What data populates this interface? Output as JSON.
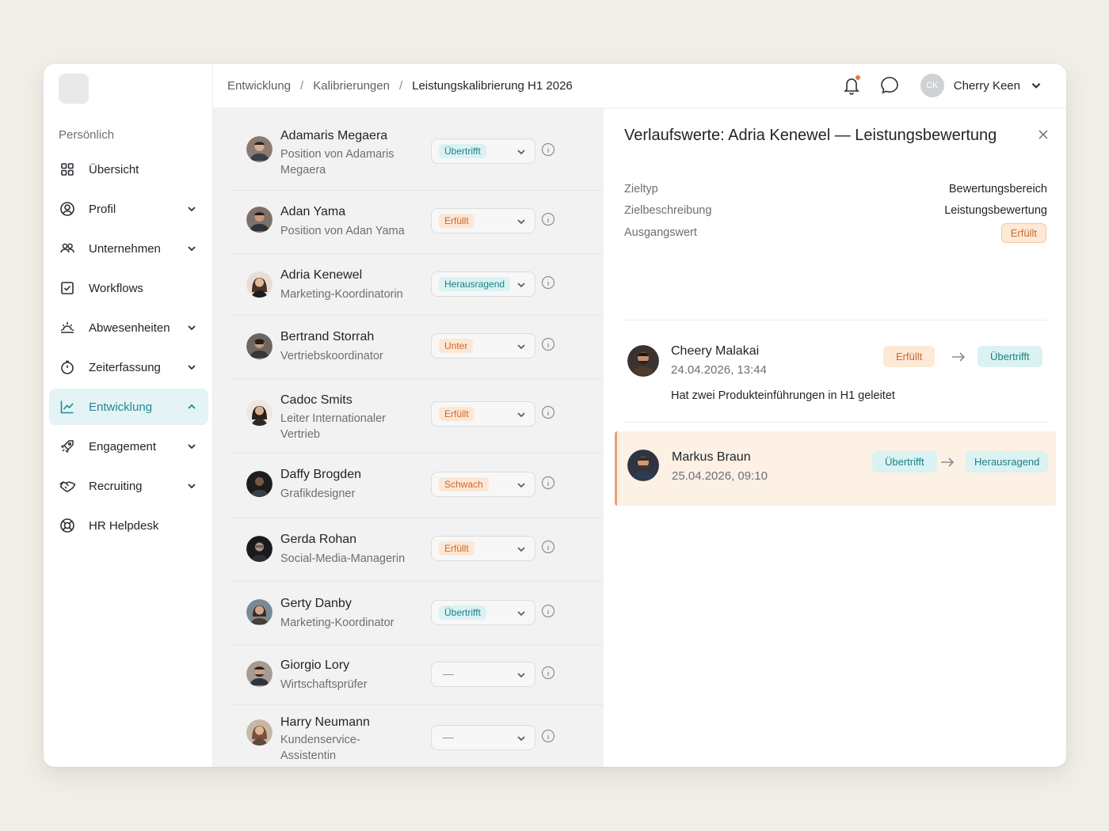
{
  "breadcrumb": {
    "items": [
      "Entwicklung",
      "Kalibrierungen"
    ],
    "separator": "/",
    "current": "Leistungskalibrierung H1 2026"
  },
  "user": {
    "initials": "CK",
    "name": "Cherry Keen"
  },
  "sidebar": {
    "section_label": "Persönlich",
    "items": [
      {
        "label": "Übersicht",
        "icon": "grid-icon"
      },
      {
        "label": "Profil",
        "icon": "user-circle-icon"
      },
      {
        "label": "Unternehmen",
        "icon": "people-icon"
      },
      {
        "label": "Workflows",
        "icon": "checkbox-icon"
      },
      {
        "label": "Abwesenheiten",
        "icon": "sunrise-icon"
      },
      {
        "label": "Zeiterfassung",
        "icon": "stopwatch-icon"
      },
      {
        "label": "Entwicklung",
        "icon": "trend-icon"
      },
      {
        "label": "Engagement",
        "icon": "rocket-icon"
      },
      {
        "label": "Recruiting",
        "icon": "handshake-icon"
      },
      {
        "label": "HR Helpdesk",
        "icon": "lifebuoy-icon"
      }
    ],
    "active": "Entwicklung"
  },
  "employees": [
    {
      "name": "Adamaris Megaera",
      "position": "Position von Adamaris Megaera",
      "rating": "Übertrifft",
      "tone": "teal"
    },
    {
      "name": "Adan Yama",
      "position": "Position von Adan Yama",
      "rating": "Erfüllt",
      "tone": "orange"
    },
    {
      "name": "Adria Kenewel",
      "position": "Marketing-Koordinatorin",
      "rating": "Herausragend",
      "tone": "teal"
    },
    {
      "name": "Bertrand Storrah",
      "position": "Vertriebskoordinator",
      "rating": "Unter",
      "tone": "orange"
    },
    {
      "name": "Cadoc Smits",
      "position": "Leiter Internationaler Vertrieb",
      "rating": "Erfüllt",
      "tone": "orange"
    },
    {
      "name": "Daffy Brogden",
      "position": "Grafikdesigner",
      "rating": "Schwach",
      "tone": "orange"
    },
    {
      "name": "Gerda Rohan",
      "position": "Social-Media-Managerin",
      "rating": "Erfüllt",
      "tone": "orange"
    },
    {
      "name": "Gerty Danby",
      "position": "Marketing-Koordinator",
      "rating": "Übertrifft",
      "tone": "teal"
    },
    {
      "name": "Giorgio Lory",
      "position": "Wirtschaftsprüfer",
      "rating": "—",
      "tone": "none"
    },
    {
      "name": "Harry Neumann",
      "position": "Kundenservice-Assistentin",
      "rating": "—",
      "tone": "none"
    }
  ],
  "detail": {
    "title": "Verlaufswerte: Adria Kenewel — Leistungsbewertung",
    "meta": [
      {
        "key": "Zieltyp",
        "value": "Bewertungsbereich"
      },
      {
        "key": "Zielbeschreibung",
        "value": "Leistungsbewertung"
      },
      {
        "key": "Ausgangswert",
        "value": "Erfüllt"
      }
    ],
    "history": [
      {
        "name": "Cheery Malakai",
        "date": "24.04.2026, 13:44",
        "from": "Erfüllt",
        "to": "Übertrifft",
        "comment": "Hat zwei Produkteinführungen in H1 geleitet"
      },
      {
        "name": "Markus Braun",
        "date": "25.04.2026, 09:10",
        "from": "Übertrifft",
        "to": "Herausragend",
        "comment": ""
      }
    ]
  },
  "colors": {
    "accent_teal": "#1f8a94",
    "chip_teal_bg": "#daf2f2",
    "chip_orange_bg": "#fde7d4",
    "chip_orange_text": "#c9682e"
  }
}
